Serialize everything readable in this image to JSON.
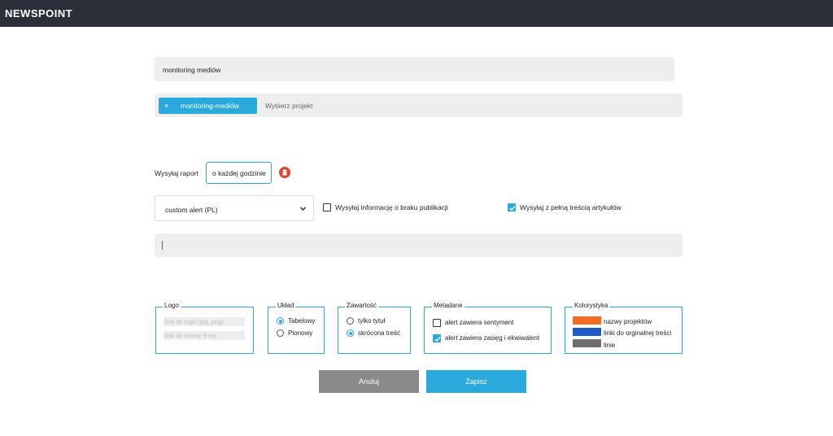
{
  "header": {
    "brand": "NEWSPOINT"
  },
  "form": {
    "alert_name": "monitoring mediów",
    "projects": {
      "tags": [
        {
          "label": "monitoring-mediów",
          "remove_glyph": "×"
        }
      ],
      "placeholder": "Wybierz projekt"
    },
    "schedule": {
      "label": "Wysyłaj raport",
      "frequency": "o każdej godzinie",
      "delete_icon": "trash-icon",
      "delete_color": "#e7402c"
    },
    "template_select": {
      "value": "custom alert (PL)",
      "icon": "chevron-down-icon"
    },
    "options": [
      {
        "label": "Wysyłaj informację o braku publikacji",
        "checked": false
      },
      {
        "label": "Wysyłaj z pełną treścią artykułów",
        "checked": true
      }
    ],
    "text_input": {
      "value": ""
    }
  },
  "sections": {
    "logo": {
      "title": "Logo",
      "inputs": [
        {
          "placeholder": "link do logo (jpg, png)"
        },
        {
          "placeholder": "link do strony firmy"
        }
      ]
    },
    "layout": {
      "title": "Układ",
      "options": [
        {
          "label": "Tabelowy",
          "selected": true
        },
        {
          "label": "Pionowy",
          "selected": false
        }
      ]
    },
    "content": {
      "title": "Zawartość",
      "options": [
        {
          "label": "tylko tytuł",
          "selected": false
        },
        {
          "label": "skrócona treść",
          "selected": true
        }
      ]
    },
    "metadata": {
      "title": "Metadane",
      "options": [
        {
          "label": "alert zawiera sentyment",
          "checked": false
        },
        {
          "label": "alert zawiera zasięg i ekwiwalent",
          "checked": true
        }
      ]
    },
    "colors": {
      "title": "Kolorystyka",
      "items": [
        {
          "label": "nazwy projektów",
          "color": "#f26d21"
        },
        {
          "label": "linki do orginalnej treści",
          "color": "#1f5bc6"
        },
        {
          "label": "linie",
          "color": "#6e6e6e"
        }
      ]
    }
  },
  "actions": {
    "cancel": "Anuluj",
    "save": "Zapisz"
  },
  "theme": {
    "accent": "#29a9dc",
    "topbar": "#2b2f3a"
  }
}
